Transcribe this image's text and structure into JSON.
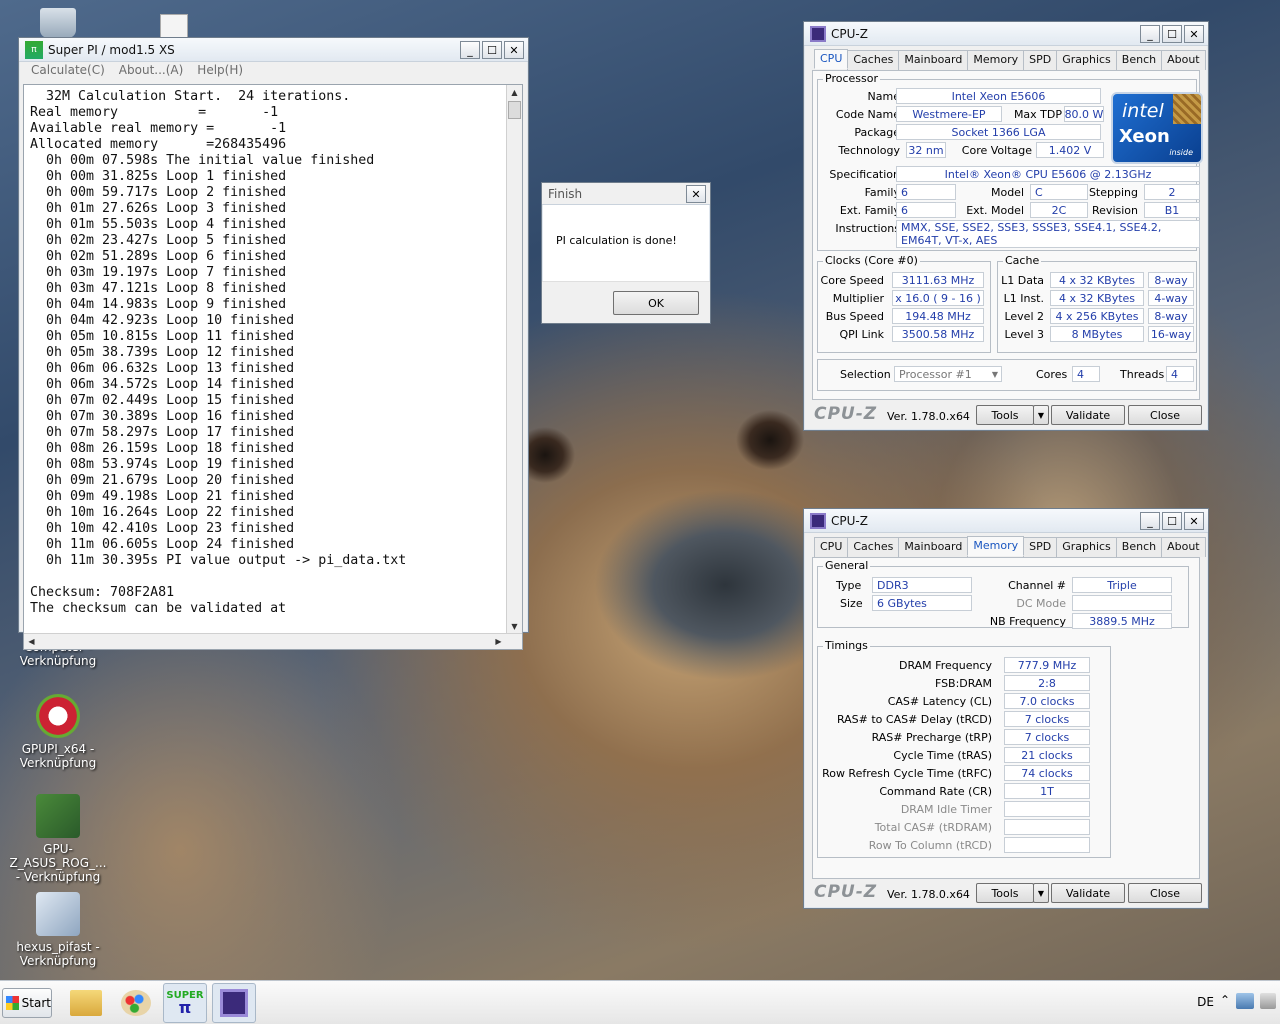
{
  "desktop": {
    "icons": [
      {
        "label": "Computer - Verknüpfung"
      },
      {
        "label": "GPUPI_x64 - Verknüpfung"
      },
      {
        "label": "GPU-Z_ASUS_ROG_... - Verknüpfung"
      },
      {
        "label": "hexus_pifast - Verknüpfung"
      }
    ]
  },
  "superpi": {
    "title": "Super PI / mod1.5 XS",
    "menu": [
      "Calculate(C)",
      "About...(A)",
      "Help(H)"
    ],
    "lines": [
      "  32M Calculation Start.  24 iterations.",
      "Real memory          =       -1",
      "Available real memory =       -1",
      "Allocated memory      =268435496",
      "  0h 00m 07.598s The initial value finished",
      "  0h 00m 31.825s Loop 1 finished",
      "  0h 00m 59.717s Loop 2 finished",
      "  0h 01m 27.626s Loop 3 finished",
      "  0h 01m 55.503s Loop 4 finished",
      "  0h 02m 23.427s Loop 5 finished",
      "  0h 02m 51.289s Loop 6 finished",
      "  0h 03m 19.197s Loop 7 finished",
      "  0h 03m 47.121s Loop 8 finished",
      "  0h 04m 14.983s Loop 9 finished",
      "  0h 04m 42.923s Loop 10 finished",
      "  0h 05m 10.815s Loop 11 finished",
      "  0h 05m 38.739s Loop 12 finished",
      "  0h 06m 06.632s Loop 13 finished",
      "  0h 06m 34.572s Loop 14 finished",
      "  0h 07m 02.449s Loop 15 finished",
      "  0h 07m 30.389s Loop 16 finished",
      "  0h 07m 58.297s Loop 17 finished",
      "  0h 08m 26.159s Loop 18 finished",
      "  0h 08m 53.974s Loop 19 finished",
      "  0h 09m 21.679s Loop 20 finished",
      "  0h 09m 49.198s Loop 21 finished",
      "  0h 10m 16.264s Loop 22 finished",
      "  0h 10m 42.410s Loop 23 finished",
      "  0h 11m 06.605s Loop 24 finished",
      "  0h 11m 30.395s PI value output -> pi_data.txt",
      "",
      "Checksum: 708F2A81",
      "The checksum can be validated at"
    ]
  },
  "finish": {
    "title": "Finish",
    "message": "PI calculation is done!",
    "ok": "OK"
  },
  "cpuz_common": {
    "title": "CPU-Z",
    "tabs": [
      "CPU",
      "Caches",
      "Mainboard",
      "Memory",
      "SPD",
      "Graphics",
      "Bench",
      "About"
    ],
    "logo": "CPU-Z",
    "version": "Ver. 1.78.0.x64",
    "tools": "Tools",
    "validate": "Validate",
    "close": "Close"
  },
  "cpu": {
    "processor_group": "Processor",
    "name_label": "Name",
    "name": "Intel Xeon E5606",
    "codename_label": "Code Name",
    "codename": "Westmere-EP",
    "maxtdp_label": "Max TDP",
    "maxtdp": "80.0 W",
    "package_label": "Package",
    "package": "Socket 1366 LGA",
    "technology_label": "Technology",
    "technology": "32 nm",
    "corevoltage_label": "Core Voltage",
    "corevoltage": "1.402 V",
    "spec_label": "Specification",
    "spec": "Intel® Xeon® CPU        E5606  @ 2.13GHz",
    "family_label": "Family",
    "family": "6",
    "model_label": "Model",
    "model": "C",
    "stepping_label": "Stepping",
    "stepping": "2",
    "extfamily_label": "Ext. Family",
    "extfamily": "6",
    "extmodel_label": "Ext. Model",
    "extmodel": "2C",
    "revision_label": "Revision",
    "revision": "B1",
    "instr_label": "Instructions",
    "instr": "MMX, SSE, SSE2, SSE3, SSSE3, SSE4.1, SSE4.2, EM64T, VT-x, AES",
    "clocks_group": "Clocks (Core #0)",
    "corespeed_label": "Core Speed",
    "corespeed": "3111.63 MHz",
    "multiplier_label": "Multiplier",
    "multiplier": "x 16.0 ( 9 - 16 )",
    "busspeed_label": "Bus Speed",
    "busspeed": "194.48 MHz",
    "qpi_label": "QPI Link",
    "qpi": "3500.58 MHz",
    "cache_group": "Cache",
    "l1d_label": "L1 Data",
    "l1d": "4 x 32 KBytes",
    "l1d_way": "8-way",
    "l1i_label": "L1 Inst.",
    "l1i": "4 x 32 KBytes",
    "l1i_way": "4-way",
    "l2_label": "Level 2",
    "l2": "4 x 256 KBytes",
    "l2_way": "8-way",
    "l3_label": "Level 3",
    "l3": "8 MBytes",
    "l3_way": "16-way",
    "selection_label": "Selection",
    "selection": "Processor #1",
    "cores_label": "Cores",
    "cores": "4",
    "threads_label": "Threads",
    "threads": "4",
    "intel_brand": "intel",
    "xeon_brand": "Xeon",
    "inside": "inside"
  },
  "memory": {
    "general_group": "General",
    "type_label": "Type",
    "type": "DDR3",
    "size_label": "Size",
    "size": "6 GBytes",
    "channel_label": "Channel #",
    "channel": "Triple",
    "dcmode_label": "DC Mode",
    "dcmode": "",
    "nbfreq_label": "NB Frequency",
    "nbfreq": "3889.5 MHz",
    "timings_group": "Timings",
    "rows": [
      {
        "label": "DRAM Frequency",
        "value": "777.9 MHz",
        "dim": false
      },
      {
        "label": "FSB:DRAM",
        "value": "2:8",
        "dim": false
      },
      {
        "label": "CAS# Latency (CL)",
        "value": "7.0 clocks",
        "dim": false
      },
      {
        "label": "RAS# to CAS# Delay (tRCD)",
        "value": "7 clocks",
        "dim": false
      },
      {
        "label": "RAS# Precharge (tRP)",
        "value": "7 clocks",
        "dim": false
      },
      {
        "label": "Cycle Time (tRAS)",
        "value": "21 clocks",
        "dim": false
      },
      {
        "label": "Row Refresh Cycle Time (tRFC)",
        "value": "74 clocks",
        "dim": false
      },
      {
        "label": "Command Rate (CR)",
        "value": "1T",
        "dim": false
      },
      {
        "label": "DRAM Idle Timer",
        "value": "",
        "dim": true
      },
      {
        "label": "Total CAS# (tRDRAM)",
        "value": "",
        "dim": true
      },
      {
        "label": "Row To Column (tRCD)",
        "value": "",
        "dim": true
      }
    ]
  },
  "taskbar": {
    "start": "Start",
    "lang": "DE",
    "superpi_label": "SUPER"
  }
}
